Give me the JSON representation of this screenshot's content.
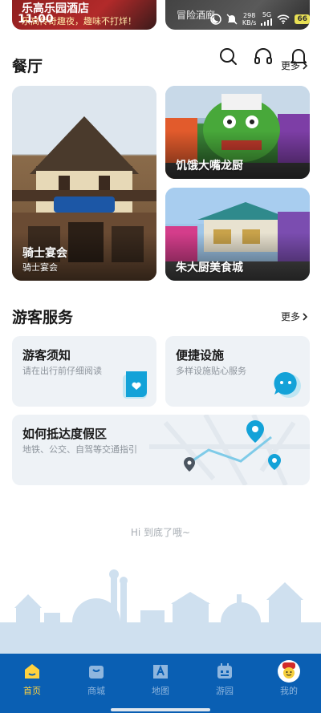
{
  "status_bar": {
    "time": "11:00",
    "speed_value": "298",
    "speed_unit": "KB/s",
    "network": "5G",
    "battery": "66"
  },
  "top_cards": {
    "left_title": "乐高乐园酒店",
    "left_subtitle": "乐高传奇趣夜，趣味不打烊！",
    "right_title": "冒险酒廊"
  },
  "header_icons": [
    "search-icon",
    "headphones-icon",
    "bell-icon"
  ],
  "restaurants": {
    "title": "餐厅",
    "more_label": "更多",
    "items": [
      {
        "name": "骑士宴会",
        "subtitle": "骑士宴会"
      },
      {
        "name": "饥饿大嘴龙厨",
        "subtitle": ""
      },
      {
        "name": "朱大厨美食城",
        "subtitle": ""
      }
    ]
  },
  "services": {
    "title": "游客服务",
    "more_label": "更多",
    "items": [
      {
        "title": "游客须知",
        "subtitle": "请在出行前仔细阅读",
        "icon": "notice-icon"
      },
      {
        "title": "便捷设施",
        "subtitle": "多样设施贴心服务",
        "icon": "chat-icon"
      },
      {
        "title": "如何抵达度假区",
        "subtitle": "地铁、公交、自驾等交通指引",
        "icon": "map-route-icon"
      }
    ]
  },
  "end_text": "Hi 到底了哦~",
  "tabs": [
    {
      "label": "首页",
      "icon": "home-icon",
      "active": true
    },
    {
      "label": "商城",
      "icon": "shopping-bag-icon",
      "active": false
    },
    {
      "label": "地图",
      "icon": "map-icon",
      "active": false
    },
    {
      "label": "游园",
      "icon": "calendar-icon",
      "active": false
    },
    {
      "label": "我的",
      "icon": "avatar-icon",
      "active": false
    }
  ],
  "colors": {
    "tabbar_bg": "#0a5fb3",
    "tab_active": "#ffd23f",
    "service_card_bg": "#eef2f6",
    "accent_blue": "#13a2d8"
  }
}
